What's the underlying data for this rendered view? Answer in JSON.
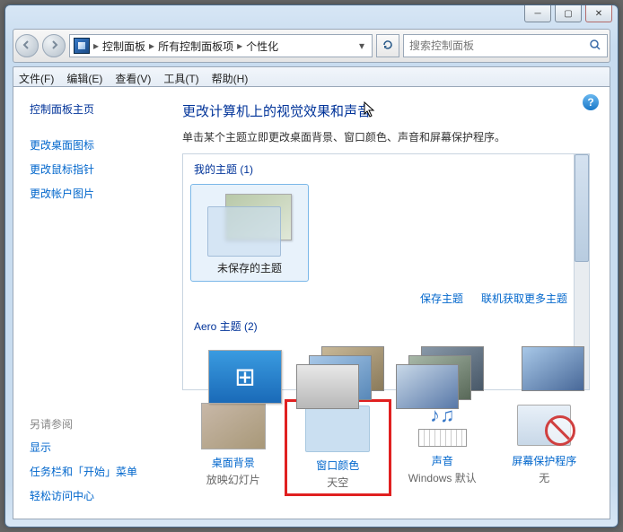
{
  "breadcrumb": [
    "控制面板",
    "所有控制面板项",
    "个性化"
  ],
  "search": {
    "placeholder": "搜索控制面板"
  },
  "menu": [
    "文件(F)",
    "编辑(E)",
    "查看(V)",
    "工具(T)",
    "帮助(H)"
  ],
  "sidebar": {
    "home": "控制面板主页",
    "links": [
      "更改桌面图标",
      "更改鼠标指针",
      "更改帐户图片"
    ],
    "related_heading": "另请参阅",
    "related": [
      "显示",
      "任务栏和「开始」菜单",
      "轻松访问中心"
    ]
  },
  "main": {
    "title": "更改计算机上的视觉效果和声音",
    "subtitle": "单击某个主题立即更改桌面背景、窗口颜色、声音和屏幕保护程序。",
    "my_themes_heading": "我的主题 (1)",
    "my_themes": [
      "未保存的主题"
    ],
    "actions": {
      "save": "保存主题",
      "more": "联机获取更多主题"
    },
    "aero_heading": "Aero 主题 (2)",
    "options": [
      {
        "title": "桌面背景",
        "value": "放映幻灯片"
      },
      {
        "title": "窗口颜色",
        "value": "天空"
      },
      {
        "title": "声音",
        "value": "Windows 默认"
      },
      {
        "title": "屏幕保护程序",
        "value": "无"
      }
    ]
  }
}
